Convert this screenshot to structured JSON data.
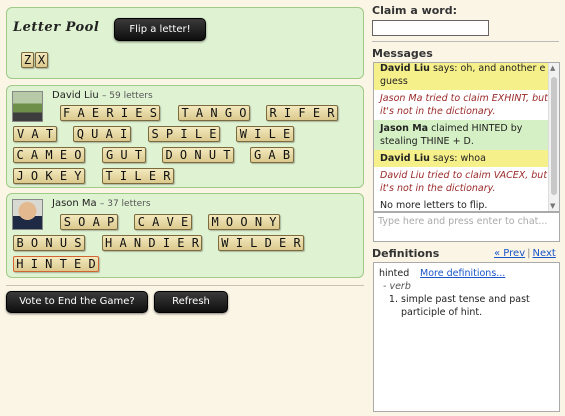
{
  "letter_pool": {
    "title": "Letter Pool",
    "flip_label": "Flip a letter!",
    "tiles": [
      "Z",
      "X"
    ]
  },
  "players": [
    {
      "name": "David Liu",
      "count": "– 59 letters",
      "words": [
        [
          "FAERIES",
          "TANGO",
          "RIFER"
        ],
        [
          "VAT",
          "QUAI",
          "SPILE",
          "WILE"
        ],
        [
          "CAMEO",
          "GUT",
          "DONUT",
          "GAB"
        ],
        [
          "JOKEY",
          "TILER"
        ]
      ]
    },
    {
      "name": "Jason Ma",
      "count": "– 37 letters",
      "words": [
        [
          "SOAP",
          "CAVE",
          "MOONY"
        ],
        [
          "BONUS",
          "HANDIER",
          "WILDER"
        ],
        [
          "HINTED"
        ]
      ]
    }
  ],
  "controls": {
    "vote_label": "Vote to End the Game?",
    "refresh_label": "Refresh"
  },
  "claim": {
    "heading": "Claim a word:",
    "value": ""
  },
  "messages": {
    "heading": "Messages",
    "items": [
      {
        "style": "yellow",
        "who": "David Liu",
        "text": " says: oh, and another e i guess"
      },
      {
        "style": "red",
        "who": "Jason Ma",
        "text": " tried to claim EXHINT, but it's not in the dictionary."
      },
      {
        "style": "green",
        "who": "Jason Ma",
        "text": " claimed HINTED by stealing THINE + D."
      },
      {
        "style": "yellow",
        "who": "David Liu",
        "text": " says: whoa"
      },
      {
        "style": "red",
        "who": "David Liu",
        "text": " tried to claim VACEX, but it's not in the dictionary."
      },
      {
        "style": "plain",
        "who": "",
        "text": "No more letters to flip."
      }
    ],
    "chat_placeholder": "Type here and press enter to chat..."
  },
  "definitions": {
    "heading": "Definitions",
    "prev": "« Prev",
    "next": "Next »",
    "word": "hinted",
    "more": "More definitions...",
    "pos": "- verb",
    "senses": [
      "simple past tense and past participle of hint."
    ]
  }
}
